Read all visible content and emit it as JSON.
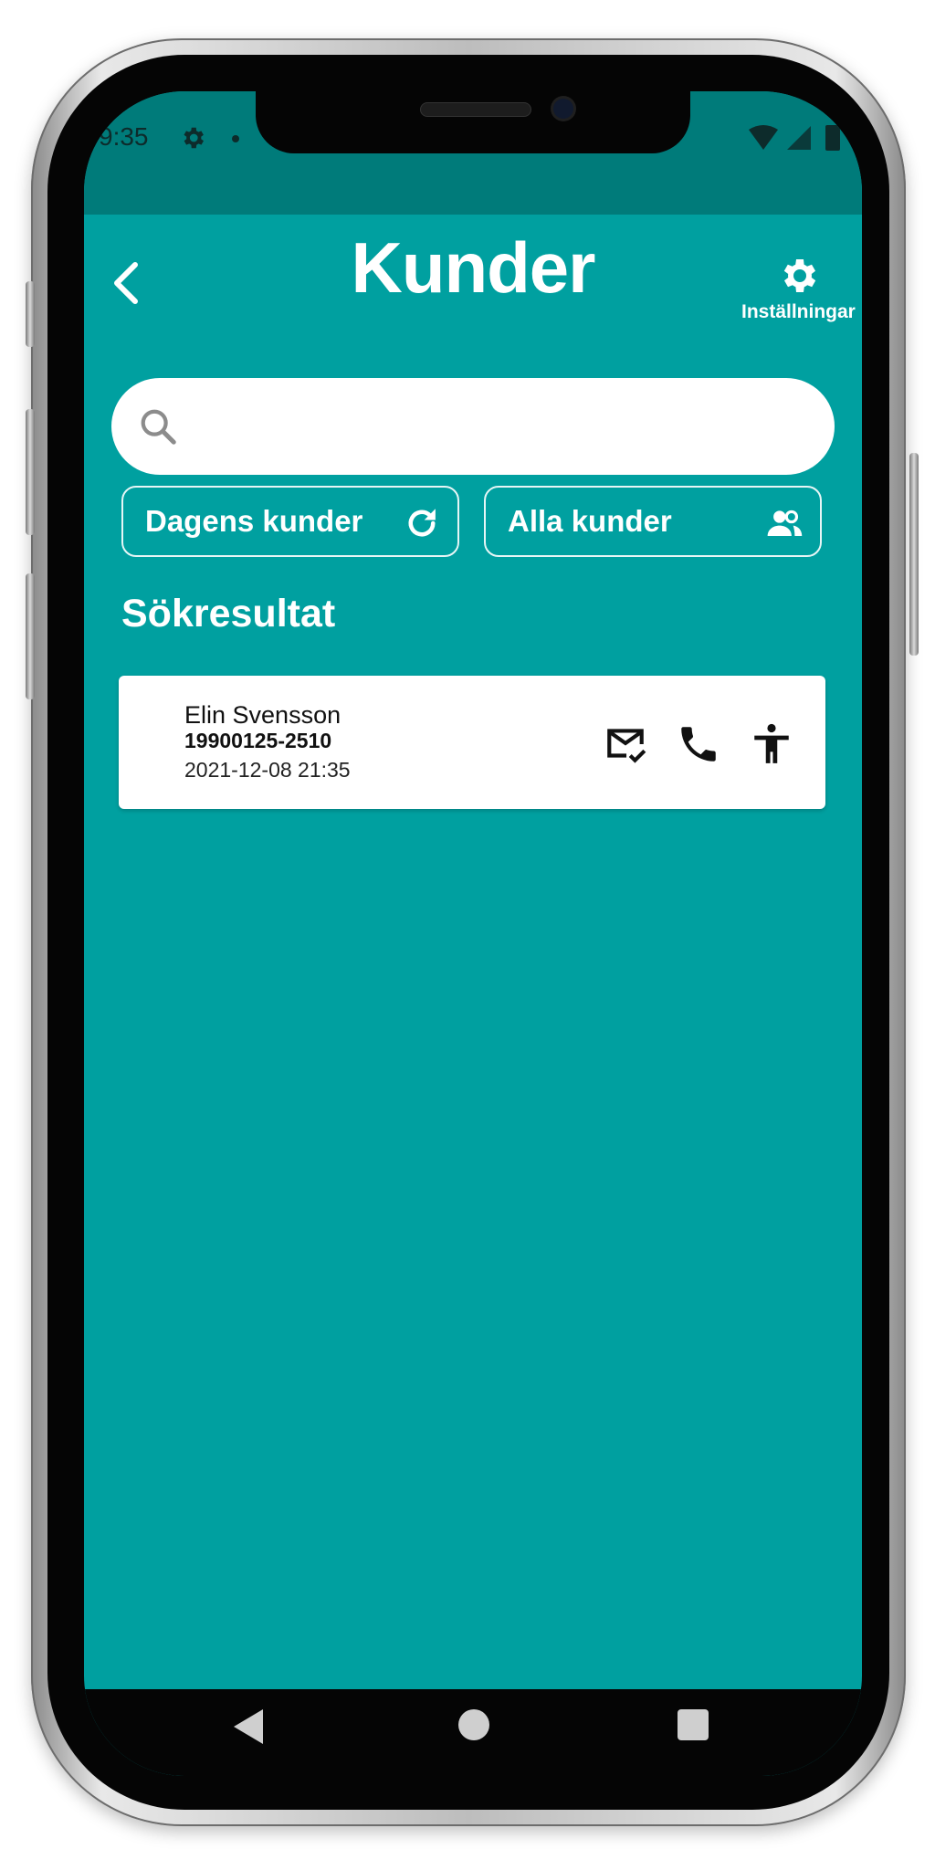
{
  "status_bar": {
    "time": "9:35",
    "icons": [
      "gear-icon",
      "dot-icon",
      "wifi-icon",
      "signal-icon",
      "battery-icon"
    ]
  },
  "header": {
    "title": "Kunder",
    "back_icon": "chevron-left-icon",
    "settings": {
      "label": "Inställningar",
      "icon": "gear-icon"
    }
  },
  "search": {
    "placeholder": "",
    "value": "",
    "icon": "search-icon"
  },
  "filters": [
    {
      "label": "Dagens kunder",
      "icon": "refresh-icon"
    },
    {
      "label": "Alla kunder",
      "icon": "people-icon"
    }
  ],
  "results": {
    "title": "Sökresultat",
    "items": [
      {
        "name": "Elin Svensson",
        "personal_number": "19900125-2510",
        "datetime": "2021-12-08 21:35",
        "actions": [
          "mail-check-icon",
          "phone-icon",
          "accessibility-icon"
        ]
      }
    ]
  },
  "nav_bar": {
    "buttons": [
      "nav-back-icon",
      "nav-home-icon",
      "nav-recent-icon"
    ]
  },
  "colors": {
    "background": "#00a0a0",
    "status_bar": "#007b7a",
    "card": "#ffffff",
    "text_light": "#ffffff"
  }
}
